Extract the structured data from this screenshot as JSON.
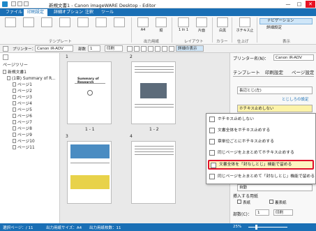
{
  "window": {
    "title": "新規文書1 - Canon imageWARE Desktop - Editor",
    "min": "—",
    "max": "□",
    "close": "✕"
  },
  "tabs": [
    "ファイル",
    "印刷設定",
    "詳細オプション",
    "注釈",
    "ツール"
  ],
  "ribbon": {
    "template_label": "テンプレート",
    "paper": {
      "size": "A4",
      "size_sub": "縦",
      "orient": "用紙",
      "group": "出力用紙"
    },
    "layout": {
      "n_up": "1 in 1",
      "n_up_sub": "(標準)",
      "duplex": "片面",
      "group": "レイアウト"
    },
    "color": {
      "label": "白黒",
      "group": "カラー"
    },
    "staple": {
      "label": "ホチキス止",
      "group": "仕上げ"
    },
    "display": {
      "navigation": "ナビゲーション",
      "detail": "詳細設定",
      "group": "表示"
    }
  },
  "toolbar2": {
    "printer_label": "プリンター：",
    "printer_value": "Canon iR-ADV",
    "copies_label": "部数",
    "copies_value": "1",
    "print_label": "印刷",
    "settings_btn": "詳細の表示"
  },
  "sidebar": {
    "header": "ページツリー",
    "doc": "新規文書1",
    "section": "(1章) Summary of R...",
    "pages": [
      "ページ1",
      "ページ2",
      "ページ3",
      "ページ4",
      "ページ5",
      "ページ6",
      "ページ7",
      "ページ8",
      "ページ9",
      "ページ10",
      "ページ11"
    ]
  },
  "canvas": {
    "pages": [
      {
        "num": "1",
        "label": "1 - 1",
        "title": "Summary of Research"
      },
      {
        "num": "2",
        "label": "1 - 2"
      },
      {
        "num": "3"
      },
      {
        "num": "4"
      }
    ]
  },
  "rpanel": {
    "printer_label": "プリンター名(N)：",
    "printer_value": "Canon iR-ADV",
    "tabs": [
      "テンプレート",
      "印刷設定",
      "ページ設定"
    ],
    "field1_value": "長辺とじ(左)",
    "link_text": "とじしろの設定",
    "staple_value": "ホチキス止めしない",
    "insert_label": "挿入する用紙",
    "insert_front": "表紙",
    "insert_back": "裏表紙",
    "pages_label": "部数(C)：",
    "pages_value": "1",
    "print_btn": "印刷",
    "last_drop": "自動"
  },
  "dropdown": {
    "items": [
      "ホチキス止めしない",
      "文書全体をホチキス止めする",
      "章単位ごとにホチキス止めする",
      "同じページを上まとめてホチキス止めする",
      "文書全体を「封なしとじ」機能で留める",
      "同じページを上まとめて「封なしとじ」機能で留める"
    ],
    "selected_index": 4
  },
  "status": {
    "pages": "選択ページ：/ 11",
    "paper": "出力用紙サイズ：A4",
    "count": "出力用紙枚数：11",
    "zoom": "25%"
  },
  "colors": {
    "accent": "#1a6fb5",
    "highlight": "#e0102a",
    "selected_bg": "#fdf3c0"
  }
}
